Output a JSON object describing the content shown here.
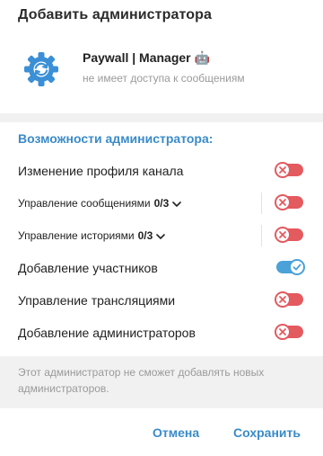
{
  "dialog": {
    "title": "Добавить администратора"
  },
  "bot": {
    "name": "Paywall | Manager",
    "emoji": "🤖",
    "status": "не имеет доступа к сообщениям",
    "avatar_icon": "gear-sync-icon",
    "avatar_color": "#3b8fd6"
  },
  "permissions": {
    "section_title": "Возможности администратора:",
    "items": [
      {
        "label": "Изменение профиля канала",
        "enabled": false
      },
      {
        "label": "Управление сообщениями",
        "counter": "0/3",
        "expandable": true,
        "enabled": false
      },
      {
        "label": "Управление историями",
        "counter": "0/3",
        "expandable": true,
        "enabled": false
      },
      {
        "label": "Добавление участников",
        "enabled": true
      },
      {
        "label": "Управление трансляциями",
        "enabled": false
      },
      {
        "label": "Добавление администраторов",
        "enabled": false
      }
    ]
  },
  "note": {
    "text": "Этот администратор не сможет добавлять новых администраторов."
  },
  "footer": {
    "cancel_label": "Отмена",
    "save_label": "Сохранить"
  },
  "colors": {
    "accent": "#3a8bc8",
    "toggle_off": "#e35a5f",
    "toggle_on": "#4aa2d8"
  }
}
